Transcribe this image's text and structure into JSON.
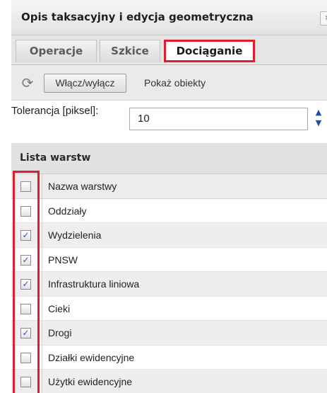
{
  "panel": {
    "title": "Opis taksacyjny i edycja geometryczna",
    "collapse_glyph": "»"
  },
  "tabs": [
    {
      "label": "Operacje",
      "active": false
    },
    {
      "label": "Szkice",
      "active": false
    },
    {
      "label": "Dociąganie",
      "active": true
    }
  ],
  "toolbar": {
    "refresh_icon": "refresh-icon",
    "toggle_label": "Włącz/wyłącz",
    "show_objects_label": "Pokaż obiekty"
  },
  "tolerance": {
    "label": "Tolerancja [piksel]:",
    "value": "10"
  },
  "layer_list": {
    "title": "Lista warstw",
    "header": {
      "label": "Nazwa warstwy",
      "checked": false
    },
    "rows": [
      {
        "label": "Oddziały",
        "checked": false
      },
      {
        "label": "Wydzielenia",
        "checked": true
      },
      {
        "label": "PNSW",
        "checked": true
      },
      {
        "label": "Infrastruktura liniowa",
        "checked": true
      },
      {
        "label": "Cieki",
        "checked": false
      },
      {
        "label": "Drogi",
        "checked": true
      },
      {
        "label": "Działki ewidencyjne",
        "checked": false
      },
      {
        "label": "Użytki ewidencyjne",
        "checked": false
      }
    ]
  },
  "colors": {
    "highlight": "#e01f2c",
    "check_mark": "#2a5bb5"
  }
}
